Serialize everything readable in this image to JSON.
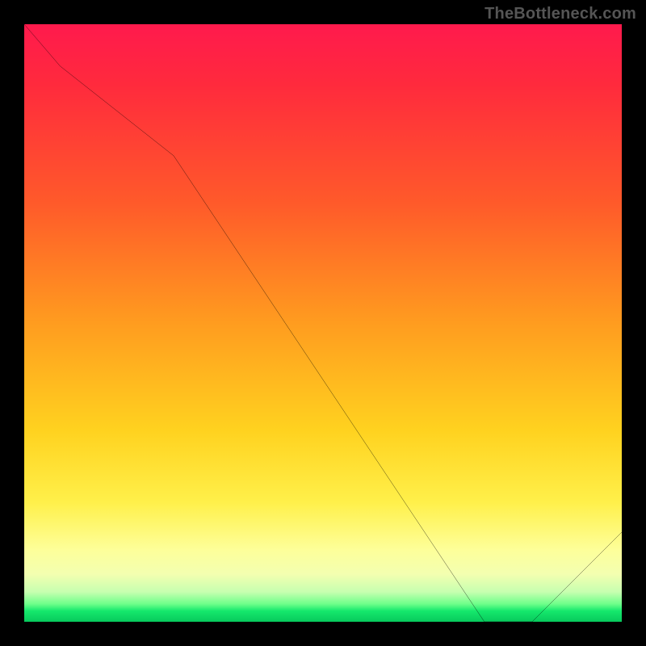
{
  "watermark": "TheBottleneck.com",
  "chart_data": {
    "type": "line",
    "title": "",
    "xlabel": "",
    "ylabel": "",
    "xlim": [
      0,
      100
    ],
    "ylim": [
      0,
      100
    ],
    "grid": false,
    "legend": false,
    "series": [
      {
        "name": "curve",
        "x": [
          0,
          6,
          25,
          77,
          85,
          100
        ],
        "y": [
          100,
          93,
          78,
          0,
          0,
          15
        ]
      }
    ],
    "annotations": [
      {
        "name": "bottom-red-label",
        "text": "",
        "x": 81,
        "y": 0.8
      }
    ],
    "background_gradient": {
      "direction": "top-to-bottom",
      "stops": [
        {
          "pos": 0.0,
          "color": "#ff1a4d"
        },
        {
          "pos": 0.3,
          "color": "#ff5a2a"
        },
        {
          "pos": 0.5,
          "color": "#ff9c1f"
        },
        {
          "pos": 0.68,
          "color": "#ffd21f"
        },
        {
          "pos": 0.88,
          "color": "#fdff9a"
        },
        {
          "pos": 0.97,
          "color": "#6fff8a"
        },
        {
          "pos": 1.0,
          "color": "#07c95c"
        }
      ]
    }
  }
}
